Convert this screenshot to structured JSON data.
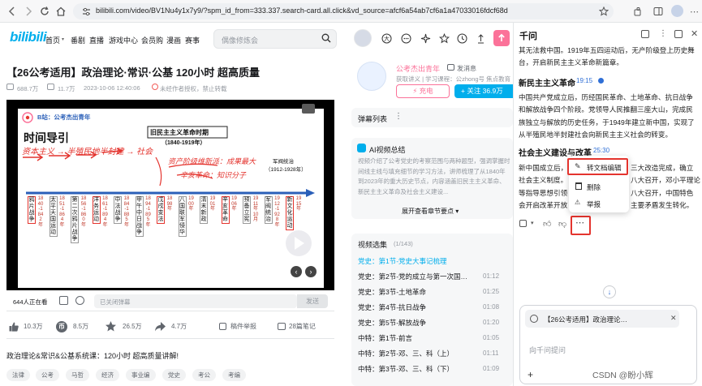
{
  "browser": {
    "url": "bilibili.com/video/BV1Nu4y1x7y9/?spm_id_from=333.337.search-card.all.click&vd_source=afcf6a54ab7cf6a1a47033016fdcf68d"
  },
  "site": {
    "logo": "bilibili",
    "nav": [
      "首页",
      "番剧",
      "直播",
      "游戏中心",
      "会员购",
      "漫画",
      "赛事"
    ],
    "search_placeholder": "偶像修炼会"
  },
  "video": {
    "title": "【26公考适用】政治理论·常识·公基 120小时 超高质量",
    "views": "688.7万",
    "danmaku_count": "11.7万",
    "date": "2023-10-06 12:40:06",
    "copyright": "未经作者授权，禁止转载",
    "watching": "644人正在看",
    "danmaku_placeholder": "已关闭弹幕",
    "send_label": "发送",
    "likes": "10.3万",
    "coins": "8.5万",
    "favorites": "26.5万",
    "shares": "4.7万",
    "report_label": "稿件举报",
    "notes_label": "28篇笔记",
    "description": "政治理论&常识&公基系统课：120小时 超高质量讲解!",
    "tags": [
      "法律",
      "公考",
      "马哲",
      "经济",
      "事业编",
      "党史",
      "考公",
      "考编"
    ]
  },
  "slide": {
    "brand": "B站：公考杰出青年",
    "heading": "时间导引",
    "boxed_title": "旧民主主义革命时期",
    "boxed_years": "（1840-1919年）",
    "right_title": "军阀统治",
    "right_years": "（1912-1928年）",
    "handwriting_1": "资本主义 → 半殖民地半封建 → 社会",
    "handwriting_2": "资产阶级维新派：成果最大",
    "handwriting_3": "辛亥革命：知识分子",
    "columns": [
      "鸦片战争",
      "太平天国运动",
      "第二次鸦片战争",
      "洋务运动",
      "中法战争",
      "甲午中日战争",
      "戊戌变法",
      "八国联军侵华",
      "清末新政",
      "辛亥革命",
      "预备立宪",
      "军阀统治",
      "新文化运动"
    ],
    "years": [
      "1840-1842年",
      "1851-1864年",
      "1856-1860年",
      "1861-1894年",
      "1884-1885年",
      "1894-1895年",
      "1898年",
      "1900年",
      "1901年",
      "1906年",
      "1911年10月",
      "1912-1928年",
      "1915年"
    ]
  },
  "uploader": {
    "name": "公考杰出青年",
    "message_label": "发消息",
    "desc": "获取讲义 | 学习课程：公zhong号 焦点教育",
    "charge_label": "充电",
    "follow_label": "+ 关注 36.9万"
  },
  "danmaku_list": {
    "label": "弹幕列表"
  },
  "ai_summary": {
    "label": "AI视频总结",
    "text": "视频介绍了公考党史的考察范围与两种题型，强调掌握时间线主线与填充细节的学习方法，讲师梳理了从1840年到2023年的重大历史节点，内容涵盖旧民主主义革命、新民主主义革命及社会主义建设...",
    "expand_label": "展开查看章节要点"
  },
  "playlist": {
    "label": "视频选集",
    "count": "(1/143)",
    "episodes": [
      {
        "title": "党史：第1节-党史大事记梳理",
        "time": "",
        "active": true
      },
      {
        "title": "党史：第2节-党的成立与第一次国…",
        "time": "01:12",
        "active": false
      },
      {
        "title": "党史：第3节-土地革命",
        "time": "01:25",
        "active": false
      },
      {
        "title": "党史：第4节-抗日战争",
        "time": "01:08",
        "active": false
      },
      {
        "title": "党史：第5节-解放战争",
        "time": "01:20",
        "active": false
      },
      {
        "title": "中特：第1节-前言",
        "time": "01:05",
        "active": false
      },
      {
        "title": "中特：第2节-邓、三、科（上）",
        "time": "01:11",
        "active": false
      },
      {
        "title": "中特：第3节-邓、三、科（下）",
        "time": "01:09",
        "active": false
      }
    ]
  },
  "chat": {
    "title": "千问",
    "para1": "其无法救中国。1919年五四运动后，无产阶级登上历史舞台，开启新民主主义革命新篇章。",
    "heading1": "新民主主义革命",
    "heading1_time": "19:15",
    "para2": "中国共产党成立后，历经国民革命、土地革命、抗日战争和解放战争四个阶段。党领导人民推翻三座大山，完成民族独立与解放的历史任务，于1949年建立新中国，实现了从半殖民地半封建社会向新民主主义社会的转变。",
    "heading2": "社会主义建设与改革",
    "heading2_time": "25:30",
    "para3_lines": [
      "新中国成立后，",
      "社会主义制度。",
      "等指导思想引领",
      "会开启改革开放"
    ],
    "para3_right": [
      "三大改造完成，确立",
      "八大召开，邓小平理论",
      "八大召开，中国特色",
      "主要矛盾发生转化。"
    ],
    "menu": [
      "转文档编辑",
      "删除",
      "举报"
    ],
    "card_title": "【26公考适用】政治理论…",
    "input_placeholder": "向千问提问",
    "watermark": "CSDN @盼小辉"
  },
  "colors": {
    "bili_pink": "#fb7299",
    "bili_blue": "#00aeec",
    "highlight": "#e4342e"
  }
}
